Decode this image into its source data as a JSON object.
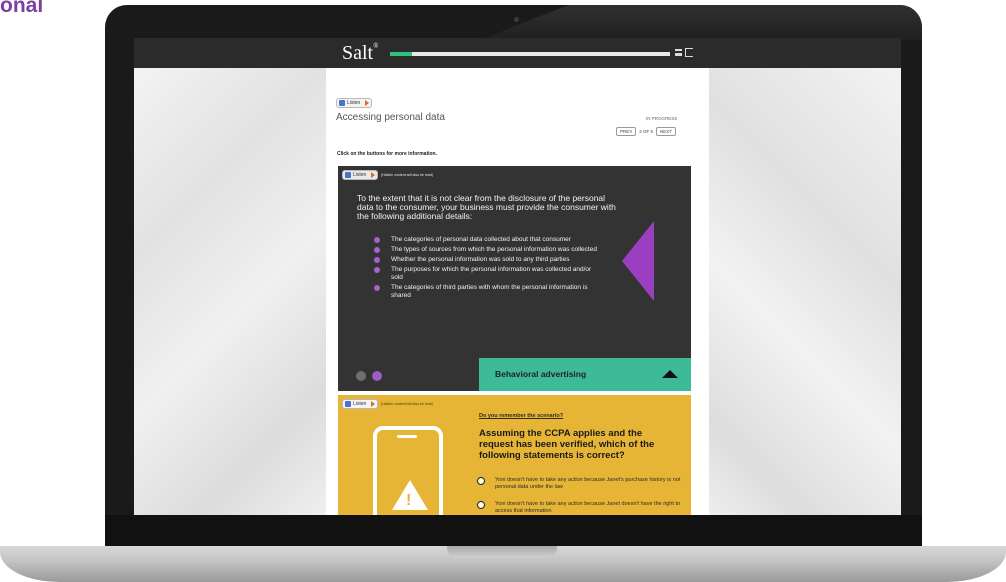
{
  "corner_text": "onal",
  "app": {
    "logo": "Salt",
    "logo_mark": "®",
    "progress_fraction": 0.08
  },
  "listen": {
    "label": "Listen"
  },
  "lesson": {
    "title": "Accessing personal data",
    "status": "IN PROGRESS",
    "prev": "PREV",
    "page_info": "2 OF 5",
    "next": "NEXT",
    "instruction": "Click on the buttons for more information."
  },
  "info_panel": {
    "hidden_note": "(Hidden content will also be read)",
    "intro": "To the extent that it is not clear from the disclosure of the personal data to the consumer, your business must provide the consumer with the following additional details:",
    "bullets": [
      "The categories of personal data collected about that consumer",
      "The types of sources from which the personal information was collected",
      "Whether the personal information was sold to any third parties",
      "The purposes for which the personal information was collected and/or sold",
      "The categories of third parties with whom the personal information is shared"
    ],
    "tab_label": "Behavioral advertising"
  },
  "scenario": {
    "hidden_note": "(Hidden content will also be read)",
    "remember_link": "Do you remember the scenario?",
    "question": "Assuming the CCPA applies and the request has been verified, which of the following statements is correct?",
    "options": [
      "Yoni doesn't have to take any action because Janet's purchase history is not personal data under the law",
      "Yoni doesn't have to take any action because Janet doesn't have the right to access that information"
    ]
  }
}
